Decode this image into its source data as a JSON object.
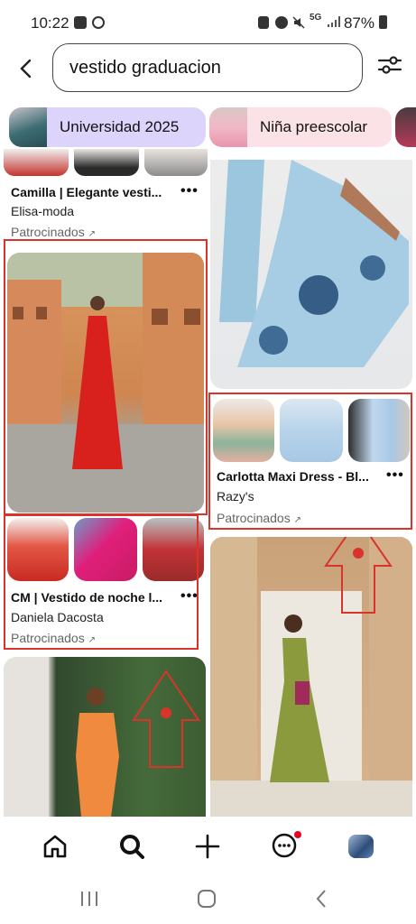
{
  "status_bar": {
    "time": "10:22",
    "battery": "87%",
    "network": "5G"
  },
  "search": {
    "query": "vestido graduacion"
  },
  "chips": [
    {
      "label": "Universidad 2025",
      "bg": "#dcd4fb"
    },
    {
      "label": "Niña preescolar",
      "bg": "#fbe2e6"
    }
  ],
  "pins": {
    "camilla": {
      "title": "Camilla | Elegante vesti...",
      "source": "Elisa-moda",
      "sponsored": "Patrocinados"
    },
    "carlotta": {
      "title": "Carlotta Maxi Dress - Bl...",
      "source": "Razy's",
      "sponsored": "Patrocinados"
    },
    "cm": {
      "title": "CM | Vestido de noche l...",
      "source": "Daniela Dacosta",
      "sponsored": "Patrocinados"
    },
    "more_label": "•••",
    "sponsored_arrow": "↗"
  },
  "colors": {
    "annotation_red": "#d9342b",
    "notification_dot": "#e60023"
  },
  "icons": [
    "home-icon",
    "search-icon",
    "plus-icon",
    "messages-icon",
    "profile-avatar",
    "recents-icon",
    "android-home-icon",
    "android-back-icon"
  ]
}
